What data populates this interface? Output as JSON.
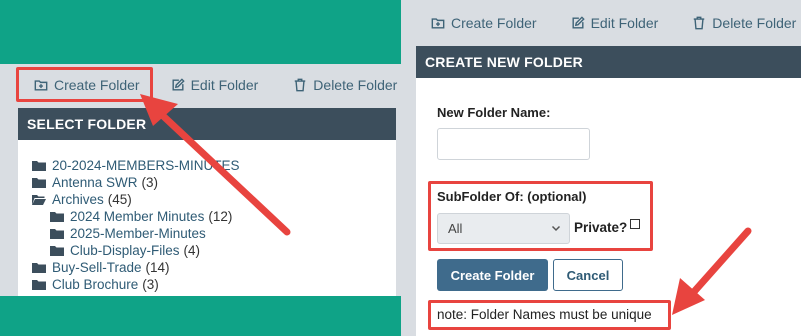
{
  "left": {
    "toolbar": {
      "create_folder": "Create Folder",
      "edit_folder": "Edit Folder",
      "delete_folder": "Delete Folder"
    },
    "panel_title": "SELECT FOLDER",
    "folders": [
      {
        "name": "20-2024-MEMBERS-MINUTES",
        "count": ""
      },
      {
        "name": "Antenna SWR",
        "count": "(3)"
      },
      {
        "name": "Archives",
        "count": "(45)"
      },
      {
        "name": "2024 Member Minutes",
        "count": "(12)"
      },
      {
        "name": "2025-Member-Minutes",
        "count": ""
      },
      {
        "name": "Club-Display-Files",
        "count": "(4)"
      },
      {
        "name": "Buy-Sell-Trade",
        "count": "(14)"
      },
      {
        "name": "Club Brochure",
        "count": "(3)"
      }
    ]
  },
  "right": {
    "toolbar": {
      "create_folder": "Create Folder",
      "edit_folder": "Edit Folder",
      "delete_folder": "Delete Folder"
    },
    "panel_title": "CREATE NEW FOLDER",
    "new_folder_label": "New Folder Name:",
    "new_folder_value": "",
    "subfolder_label": "SubFolder Of: (optional)",
    "subfolder_selected": "All",
    "private_label": "Private?",
    "create_button": "Create Folder",
    "cancel_button": "Cancel",
    "note": "note: Folder Names must be unique"
  },
  "colors": {
    "teal": "#0fa387",
    "header": "#3c4e5c",
    "link": "#2f5b75",
    "primary": "#3f6b8c",
    "highlight": "#e8443f"
  }
}
